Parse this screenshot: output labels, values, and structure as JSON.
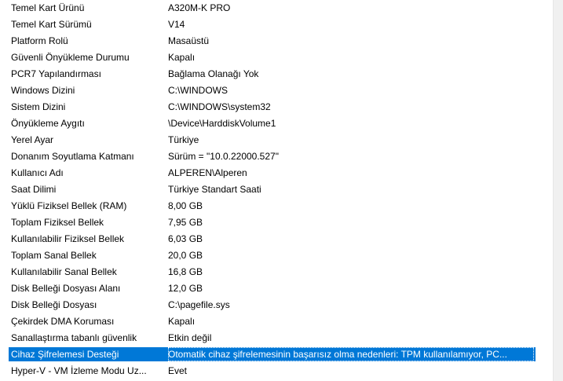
{
  "rows": [
    {
      "name": "Temel Kart Ürünü",
      "value": "A320M-K PRO"
    },
    {
      "name": "Temel Kart Sürümü",
      "value": "V14"
    },
    {
      "name": "Platform Rolü",
      "value": "Masaüstü"
    },
    {
      "name": "Güvenli Önyükleme Durumu",
      "value": "Kapalı"
    },
    {
      "name": "PCR7 Yapılandırması",
      "value": "Bağlama Olanağı Yok"
    },
    {
      "name": "Windows Dizini",
      "value": "C:\\WINDOWS"
    },
    {
      "name": "Sistem Dizini",
      "value": "C:\\WINDOWS\\system32"
    },
    {
      "name": "Önyükleme Aygıtı",
      "value": "\\Device\\HarddiskVolume1"
    },
    {
      "name": "Yerel Ayar",
      "value": "Türkiye"
    },
    {
      "name": "Donanım Soyutlama Katmanı",
      "value": "Sürüm = \"10.0.22000.527\""
    },
    {
      "name": "Kullanıcı Adı",
      "value": "ALPEREN\\Alperen"
    },
    {
      "name": "Saat Dilimi",
      "value": "Türkiye Standart Saati"
    },
    {
      "name": "Yüklü Fiziksel Bellek (RAM)",
      "value": "8,00 GB"
    },
    {
      "name": "Toplam Fiziksel Bellek",
      "value": "7,95 GB"
    },
    {
      "name": "Kullanılabilir Fiziksel Bellek",
      "value": "6,03 GB"
    },
    {
      "name": "Toplam Sanal Bellek",
      "value": "20,0 GB"
    },
    {
      "name": "Kullanılabilir Sanal Bellek",
      "value": "16,8 GB"
    },
    {
      "name": "Disk Belleği Dosyası Alanı",
      "value": "12,0 GB"
    },
    {
      "name": "Disk Belleği Dosyası",
      "value": "C:\\pagefile.sys"
    },
    {
      "name": "Çekirdek DMA Koruması",
      "value": "Kapalı"
    },
    {
      "name": "Sanallaştırma tabanlı güvenlik",
      "value": "Etkin değil"
    },
    {
      "name": "Cihaz Şifrelemesi Desteği",
      "value": "Otomatik cihaz şifrelemesinin başarısız olma nedenleri: TPM kullanılamıyor, PC...",
      "selected": true
    },
    {
      "name": "Hyper-V - VM İzleme Modu Uz...",
      "value": "Evet"
    }
  ],
  "colors": {
    "selection": "#0078d7",
    "selection_text": "#ffffff",
    "background": "#ffffff"
  }
}
